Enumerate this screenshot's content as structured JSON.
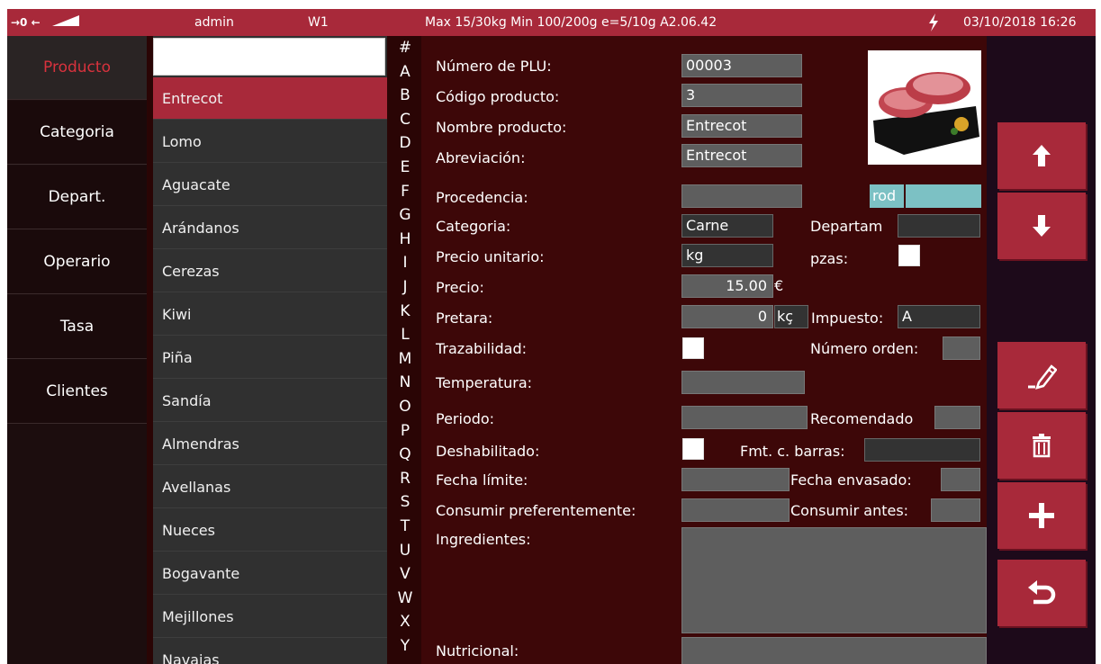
{
  "status_bar": {
    "indicators": "→0 ←",
    "user": "admin",
    "workstation": "W1",
    "scale_info": "Max 15/30kg  Min 100/200g e=5/10g  A2.06.42",
    "datetime": "03/10/2018 16:26",
    "power_icon": "lightning-icon"
  },
  "nav": {
    "items": [
      {
        "label": "Producto",
        "active": true
      },
      {
        "label": "Categoria",
        "active": false
      },
      {
        "label": "Depart.",
        "active": false
      },
      {
        "label": "Operario",
        "active": false
      },
      {
        "label": "Tasa",
        "active": false
      },
      {
        "label": "Clientes",
        "active": false
      }
    ]
  },
  "product_list": {
    "search_value": "",
    "items": [
      "Entrecot",
      "Lomo",
      "Aguacate",
      "Arándanos",
      "Cerezas",
      "Kiwi",
      "Piña",
      "Sandía",
      "Almendras",
      "Avellanas",
      "Nueces",
      "Bogavante",
      "Mejillones",
      "Navajas"
    ],
    "selected_index": 0
  },
  "alphabet": [
    "#",
    "A",
    "B",
    "C",
    "D",
    "E",
    "F",
    "G",
    "H",
    "I",
    "J",
    "K",
    "L",
    "M",
    "N",
    "O",
    "P",
    "Q",
    "R",
    "S",
    "T",
    "U",
    "V",
    "W",
    "X",
    "Y"
  ],
  "form": {
    "plu_label": "Número de PLU:",
    "plu_value": "00003",
    "code_label": "Código producto:",
    "code_value": "3",
    "name_label": "Nombre producto:",
    "name_value": "Entrecot",
    "abbr_label": "Abreviación:",
    "abbr_value": "Entrecot",
    "origin_label": "Procedencia:",
    "origin_value": "",
    "image_field_left": "rod",
    "category_label": "Categoria:",
    "category_value": "Carne",
    "department_label": "Departam",
    "department_value": "",
    "unit_price_label": "Precio unitario:",
    "unit_price_value": "kg",
    "pieces_label": "pzas:",
    "price_label": "Precio:",
    "price_value": "15.00",
    "currency": "€",
    "tare_label": "Pretara:",
    "tare_value": "0",
    "tare_unit": "kç",
    "tax_label": "Impuesto:",
    "tax_value": "A",
    "traceability_label": "Trazabilidad:",
    "order_label": "Número orden:",
    "order_value": "",
    "temperature_label": "Temperatura:",
    "temperature_value": "",
    "period_label": "Periodo:",
    "period_value": "",
    "recommended_label": "Recomendado",
    "recommended_value": "",
    "disabled_label": "Deshabilitado:",
    "barcode_label": "Fmt. c. barras:",
    "barcode_value": "",
    "limit_date_label": "Fecha límite:",
    "limit_date_value": "",
    "pack_date_label": "Fecha envasado:",
    "pack_date_value": "",
    "best_before_label": "Consumir preferentemente:",
    "best_before_value": "",
    "use_by_label": "Consumir antes:",
    "use_by_value": "",
    "ingredients_label": "Ingredientes:",
    "ingredients_value": "",
    "nutritional_label": "Nutricional:",
    "nutritional_value": ""
  },
  "right_buttons": [
    {
      "icon": "arrow-up-icon"
    },
    {
      "icon": "arrow-down-icon"
    },
    {
      "icon": "edit-pencil-icon"
    },
    {
      "icon": "trash-icon"
    },
    {
      "icon": "plus-icon"
    },
    {
      "icon": "back-return-icon"
    }
  ],
  "colors": {
    "accent": "#a8293a",
    "form_bg": "#3d0708",
    "list_bg": "#303030",
    "image_field": "#7cc1c4"
  }
}
